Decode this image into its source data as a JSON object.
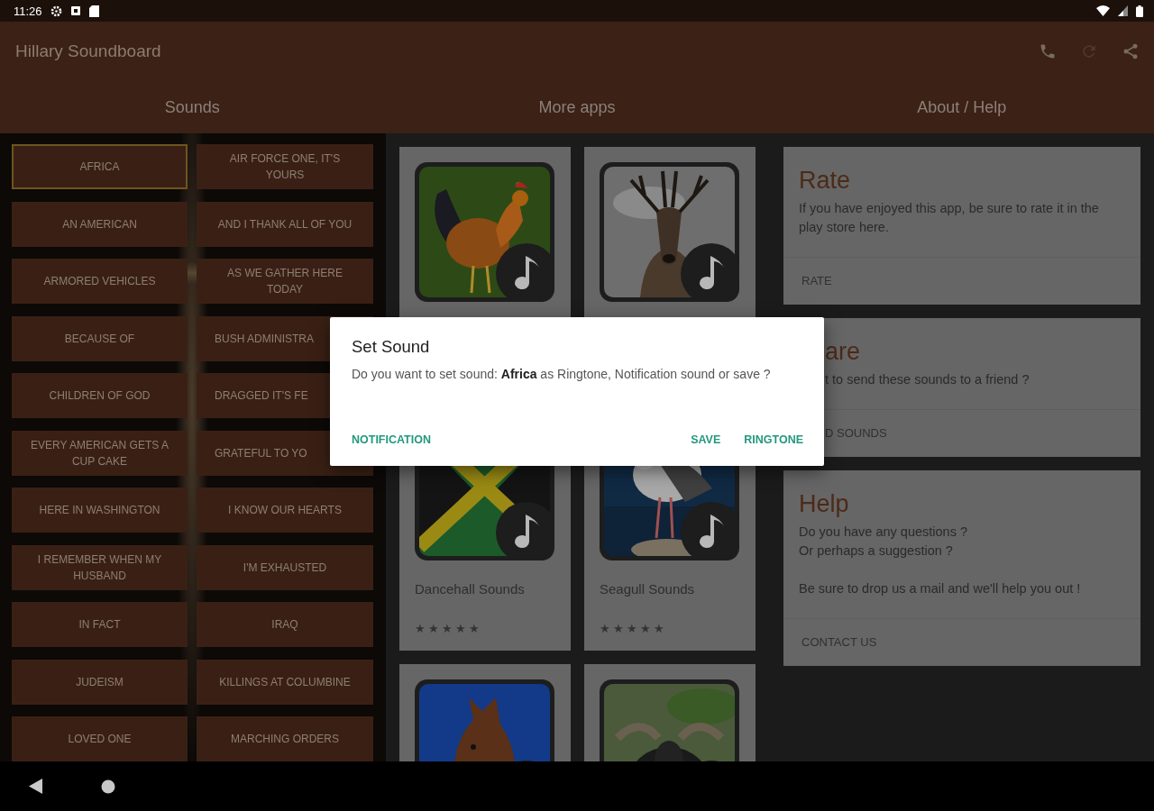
{
  "status_bar": {
    "time": "11:26"
  },
  "app_bar": {
    "title": "Hillary Soundboard"
  },
  "tabs": [
    {
      "label": "Sounds"
    },
    {
      "label": "More apps"
    },
    {
      "label": "About / Help"
    }
  ],
  "sound_buttons": [
    {
      "label": "AFRICA",
      "selected": true,
      "kind": "full"
    },
    {
      "label": "AIR FORCE ONE, IT'S YOURS",
      "selected": false,
      "kind": "full"
    },
    {
      "label": "AN AMERICAN",
      "selected": false,
      "kind": "full"
    },
    {
      "label": "AND I THANK ALL OF YOU",
      "selected": false,
      "kind": "full"
    },
    {
      "label": "ARMORED VEHICLES",
      "selected": false,
      "kind": "full"
    },
    {
      "label": "AS WE GATHER HERE TODAY",
      "selected": false,
      "kind": "full"
    },
    {
      "label": "BECAUSE OF",
      "selected": false,
      "kind": "full"
    },
    {
      "label": "BUSH ADMINISTRA",
      "selected": false,
      "kind": "covered"
    },
    {
      "label": "CHILDREN OF GOD",
      "selected": false,
      "kind": "full"
    },
    {
      "label": "DRAGGED IT'S FE",
      "selected": false,
      "kind": "covered"
    },
    {
      "label": "EVERY AMERICAN GETS A CUP CAKE",
      "selected": false,
      "kind": "full"
    },
    {
      "label": "GRATEFUL TO YO",
      "selected": false,
      "kind": "covered"
    },
    {
      "label": "HERE IN WASHINGTON",
      "selected": false,
      "kind": "full"
    },
    {
      "label": "I KNOW OUR HEARTS",
      "selected": false,
      "kind": "full"
    },
    {
      "label": "I REMEMBER WHEN MY HUSBAND",
      "selected": false,
      "kind": "full"
    },
    {
      "label": "I'M EXHAUSTED",
      "selected": false,
      "kind": "full"
    },
    {
      "label": "IN FACT",
      "selected": false,
      "kind": "full"
    },
    {
      "label": "IRAQ",
      "selected": false,
      "kind": "full"
    },
    {
      "label": "JUDEISM",
      "selected": false,
      "kind": "full"
    },
    {
      "label": "KILLINGS AT COLUMBINE",
      "selected": false,
      "kind": "full"
    },
    {
      "label": "LOVED ONE",
      "selected": false,
      "kind": "full"
    },
    {
      "label": "MARCHING ORDERS",
      "selected": false,
      "kind": "full"
    }
  ],
  "more_apps": [
    {
      "kind": "picture"
    },
    {
      "kind": "picture"
    },
    {
      "kind": "picture",
      "name": "Dancehall Sounds",
      "stars": 5
    },
    {
      "kind": "picture",
      "name": "Seagull Sounds",
      "stars": 5
    },
    {
      "kind": "picture"
    },
    {
      "kind": "picture"
    }
  ],
  "about_cards": [
    {
      "kind": "full",
      "title": "Rate",
      "paragraphs": [
        "If you have enjoyed this app, be sure to rate it in the play store here."
      ],
      "action": "RATE"
    },
    {
      "kind": "covered",
      "title": "are",
      "paragraphs": [
        "t to send these sounds to a friend ?"
      ],
      "action": "D SOUNDS"
    },
    {
      "kind": "full",
      "title": "Help",
      "paragraphs": [
        "Do you have any questions ?\nOr perhaps a suggestion ?",
        "Be sure to drop us a mail and we'll help you out !"
      ],
      "action": "CONTACT US"
    }
  ],
  "dialog": {
    "title": "Set Sound",
    "message": "Do you want to set sound: **Africa** as Ringtone, Notification sound or save ?",
    "neutral_button": "NOTIFICATION",
    "buttons": [
      "SAVE",
      "RINGTONE"
    ]
  }
}
